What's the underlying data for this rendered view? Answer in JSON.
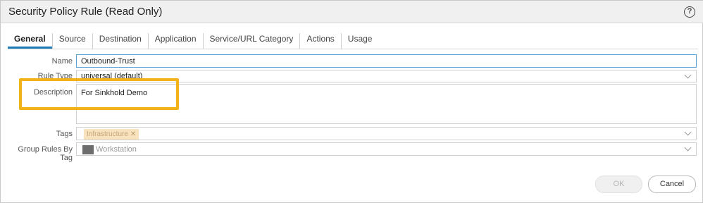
{
  "dialog": {
    "title": "Security Policy Rule (Read Only)",
    "help_glyph": "?"
  },
  "tabs": [
    {
      "label": "General",
      "active": true
    },
    {
      "label": "Source"
    },
    {
      "label": "Destination"
    },
    {
      "label": "Application"
    },
    {
      "label": "Service/URL Category"
    },
    {
      "label": "Actions"
    },
    {
      "label": "Usage"
    }
  ],
  "form": {
    "name_label": "Name",
    "name_value": "Outbound-Trust",
    "rule_type_label": "Rule Type",
    "rule_type_value": "universal (default)",
    "description_label": "Description",
    "description_value": "For Sinkhold Demo",
    "tags_label": "Tags",
    "tag_value": "Infrastructure",
    "tag_remove_glyph": "✕",
    "group_label": "Group Rules By Tag",
    "group_value": "Workstation",
    "group_swatch_color": "#6d6d6d"
  },
  "buttons": {
    "ok": "OK",
    "cancel": "Cancel"
  },
  "colors": {
    "highlight": "#f2b21a",
    "tab_accent": "#1f7ab8",
    "tag_chip_bg": "#f7e2bd"
  }
}
